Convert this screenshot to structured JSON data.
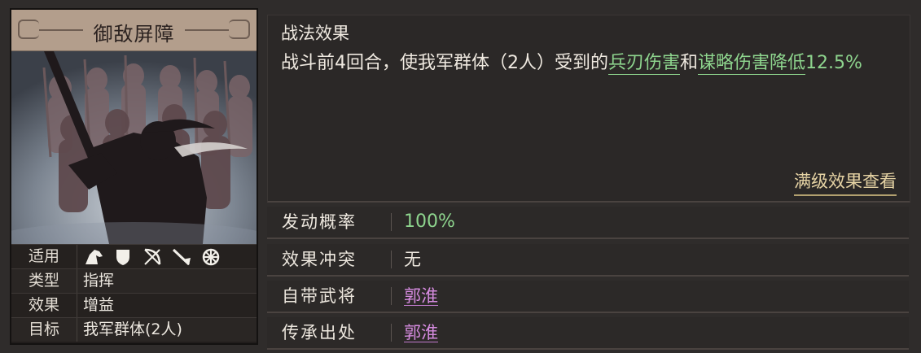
{
  "card": {
    "title": "御敌屏障",
    "rows": [
      {
        "label": "适用",
        "value": null,
        "icons": [
          "cavalry-icon",
          "shield-icon",
          "bow-icon",
          "spear-icon",
          "wheel-icon"
        ]
      },
      {
        "label": "类型",
        "value": "指挥"
      },
      {
        "label": "效果",
        "value": "增益"
      },
      {
        "label": "目标",
        "value": "我军群体(2人)"
      }
    ]
  },
  "effect": {
    "title": "战法效果",
    "text_a": "战斗前4回合，使我军群体（2人）受到的",
    "kw1": "兵刃伤害",
    "text_b": "和",
    "kw2": "谋略伤害降低",
    "pct": "12.5%",
    "max_link": "满级效果查看"
  },
  "stats": [
    {
      "label": "发动概率",
      "value": "100%"
    },
    {
      "label": "效果冲突",
      "value": "无"
    },
    {
      "label": "自带武将",
      "value": "郭淮"
    },
    {
      "label": "传承出处",
      "value": "郭淮"
    }
  ],
  "colors": {
    "keyword_green": "#8ed58e",
    "general_purple": "#d68be0",
    "link_gold": "#e6d3a4",
    "card_header": "#b39e8c"
  }
}
